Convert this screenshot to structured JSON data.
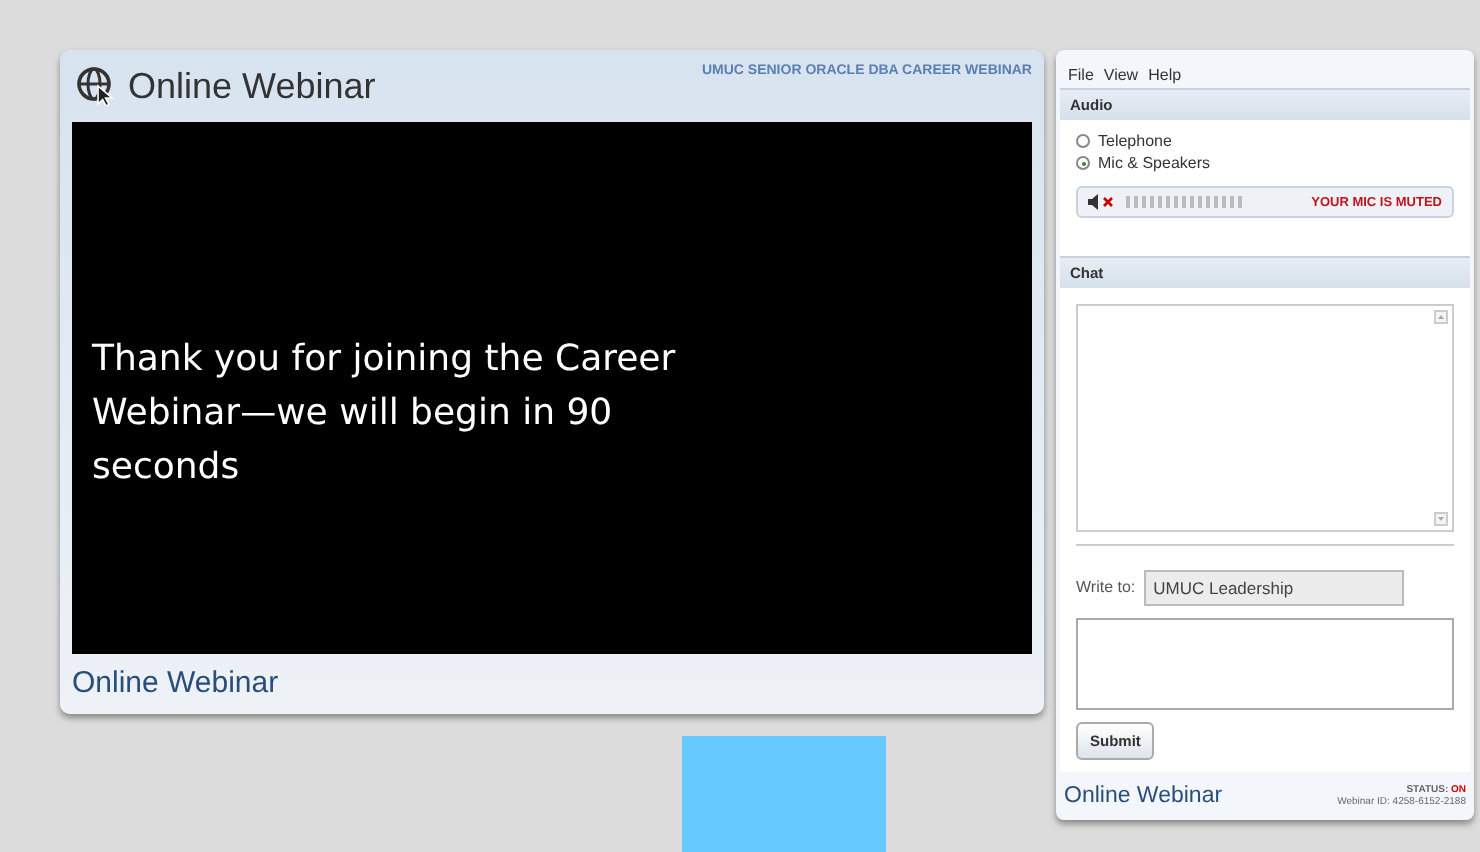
{
  "main_window": {
    "title": "Online Webinar",
    "event_title": "UMUC SENIOR ORACLE DBA CAREER WEBINAR",
    "message": "Thank you for joining the Career Webinar—we will begin in 90 seconds",
    "footer": "Online Webinar"
  },
  "side_panel": {
    "menu": [
      "File",
      "View",
      "Help"
    ],
    "audio": {
      "heading": "Audio",
      "options": [
        {
          "label": "Telephone",
          "selected": false
        },
        {
          "label": "Mic & Speakers",
          "selected": true
        }
      ],
      "mic_muted": true,
      "mic_status": "YOUR MIC IS MUTED"
    },
    "chat": {
      "heading": "Chat",
      "write_to_label": "Write to:",
      "write_to_value": "UMUC Leadership",
      "submit": "Submit"
    },
    "footer": {
      "brand": "Online Webinar",
      "status_label": "STATUS:",
      "status_value": "ON",
      "webinar_id": "Webinar ID: 4258-6152-2188"
    }
  }
}
